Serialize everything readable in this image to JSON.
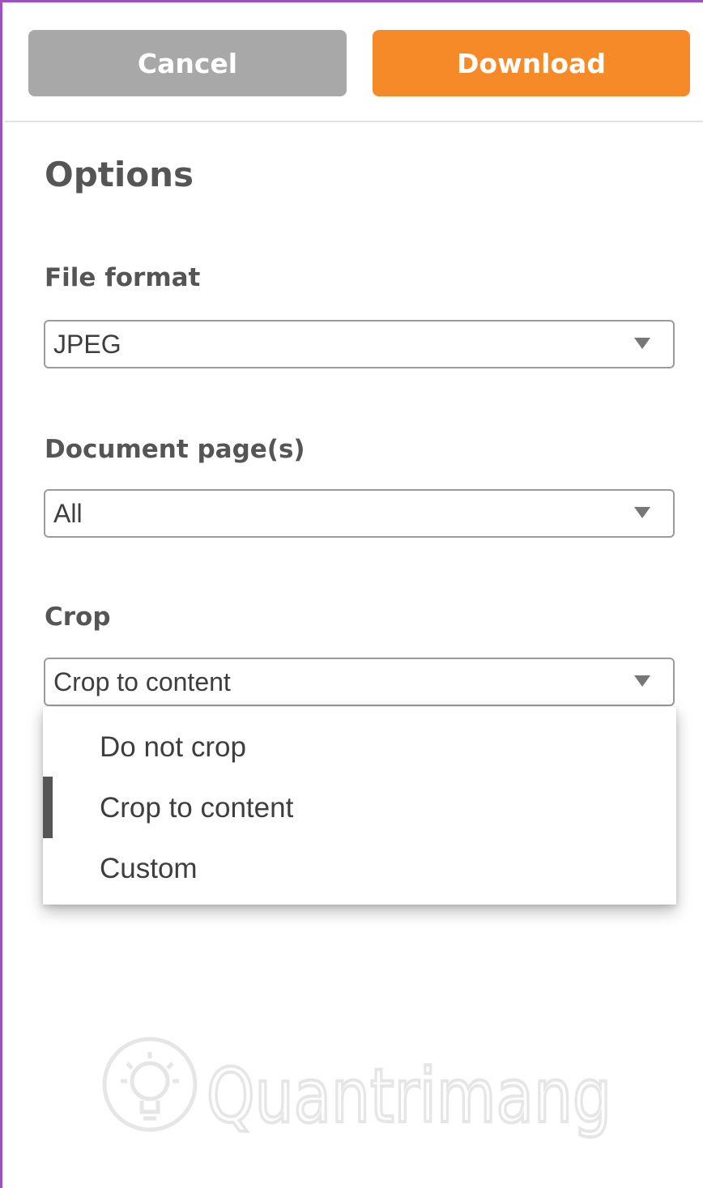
{
  "toolbar": {
    "cancel_label": "Cancel",
    "download_label": "Download"
  },
  "panel": {
    "title": "Options"
  },
  "file_format": {
    "label": "File format",
    "value": "JPEG"
  },
  "document_pages": {
    "label": "Document page(s)",
    "value": "All"
  },
  "crop": {
    "label": "Crop",
    "value": "Crop to content",
    "options": [
      {
        "label": "Do not crop"
      },
      {
        "label": "Crop to content",
        "selected": true
      },
      {
        "label": "Custom"
      }
    ]
  },
  "watermark": {
    "text": "Quantrimang",
    "icon": "lightbulb-icon"
  },
  "colors": {
    "frame_border": "#a04fc4",
    "cancel_bg": "#a8a8a8",
    "download_bg": "#f78a28",
    "text": "#555555"
  },
  "icons": {
    "dropdown_caret": "triangle-down-icon"
  }
}
